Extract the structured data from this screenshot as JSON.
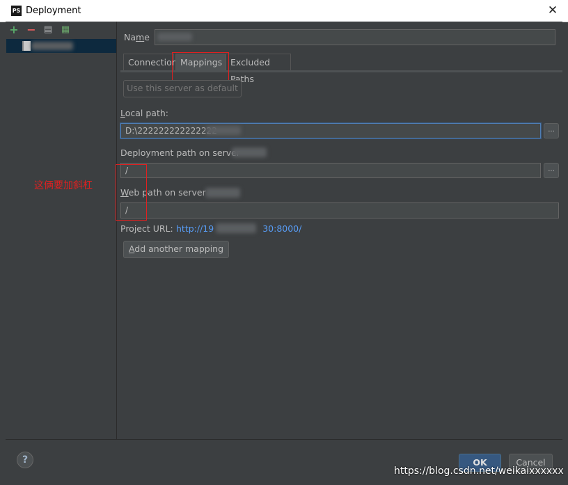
{
  "window": {
    "title": "Deployment",
    "logo_text": "PS",
    "close_glyph": "✕"
  },
  "toolbar": {
    "add_glyph": "+",
    "remove_glyph": "−",
    "copy_glyph": "▤",
    "default_glyph": "▦"
  },
  "form": {
    "name_label_pre": "Na",
    "name_label_mn": "m",
    "name_label_post": "e",
    "tabs": [
      {
        "label": "Connection"
      },
      {
        "label": "Mappings"
      },
      {
        "label": "Excluded Paths"
      }
    ],
    "use_default_button": "Use this server as default",
    "local_path_label_u": "L",
    "local_path_label_rest": "ocal path:",
    "local_path_value": "D:\\222222222222222",
    "deployment_path_label": "Deployment path on server",
    "deployment_path_value": "/",
    "web_path_label_u": "W",
    "web_path_label_rest": "eb path on server",
    "web_path_value": "/",
    "project_url_label": "Project URL:",
    "project_url_pre": "http://19",
    "project_url_post": "30:8000/",
    "add_mapping_pre": "A",
    "add_mapping_rest": "dd another mapping",
    "browse_glyph": "..."
  },
  "annotation": {
    "text": "这俩要加斜杠"
  },
  "footer": {
    "help_glyph": "?",
    "ok_label": "OK",
    "cancel_label": "Cancel",
    "watermark": "https://blog.csdn.net/weikaixxxxxx"
  },
  "colors": {
    "background": "#3c3f41",
    "accent": "#365880",
    "link": "#589df6",
    "annotation": "#e02020"
  }
}
